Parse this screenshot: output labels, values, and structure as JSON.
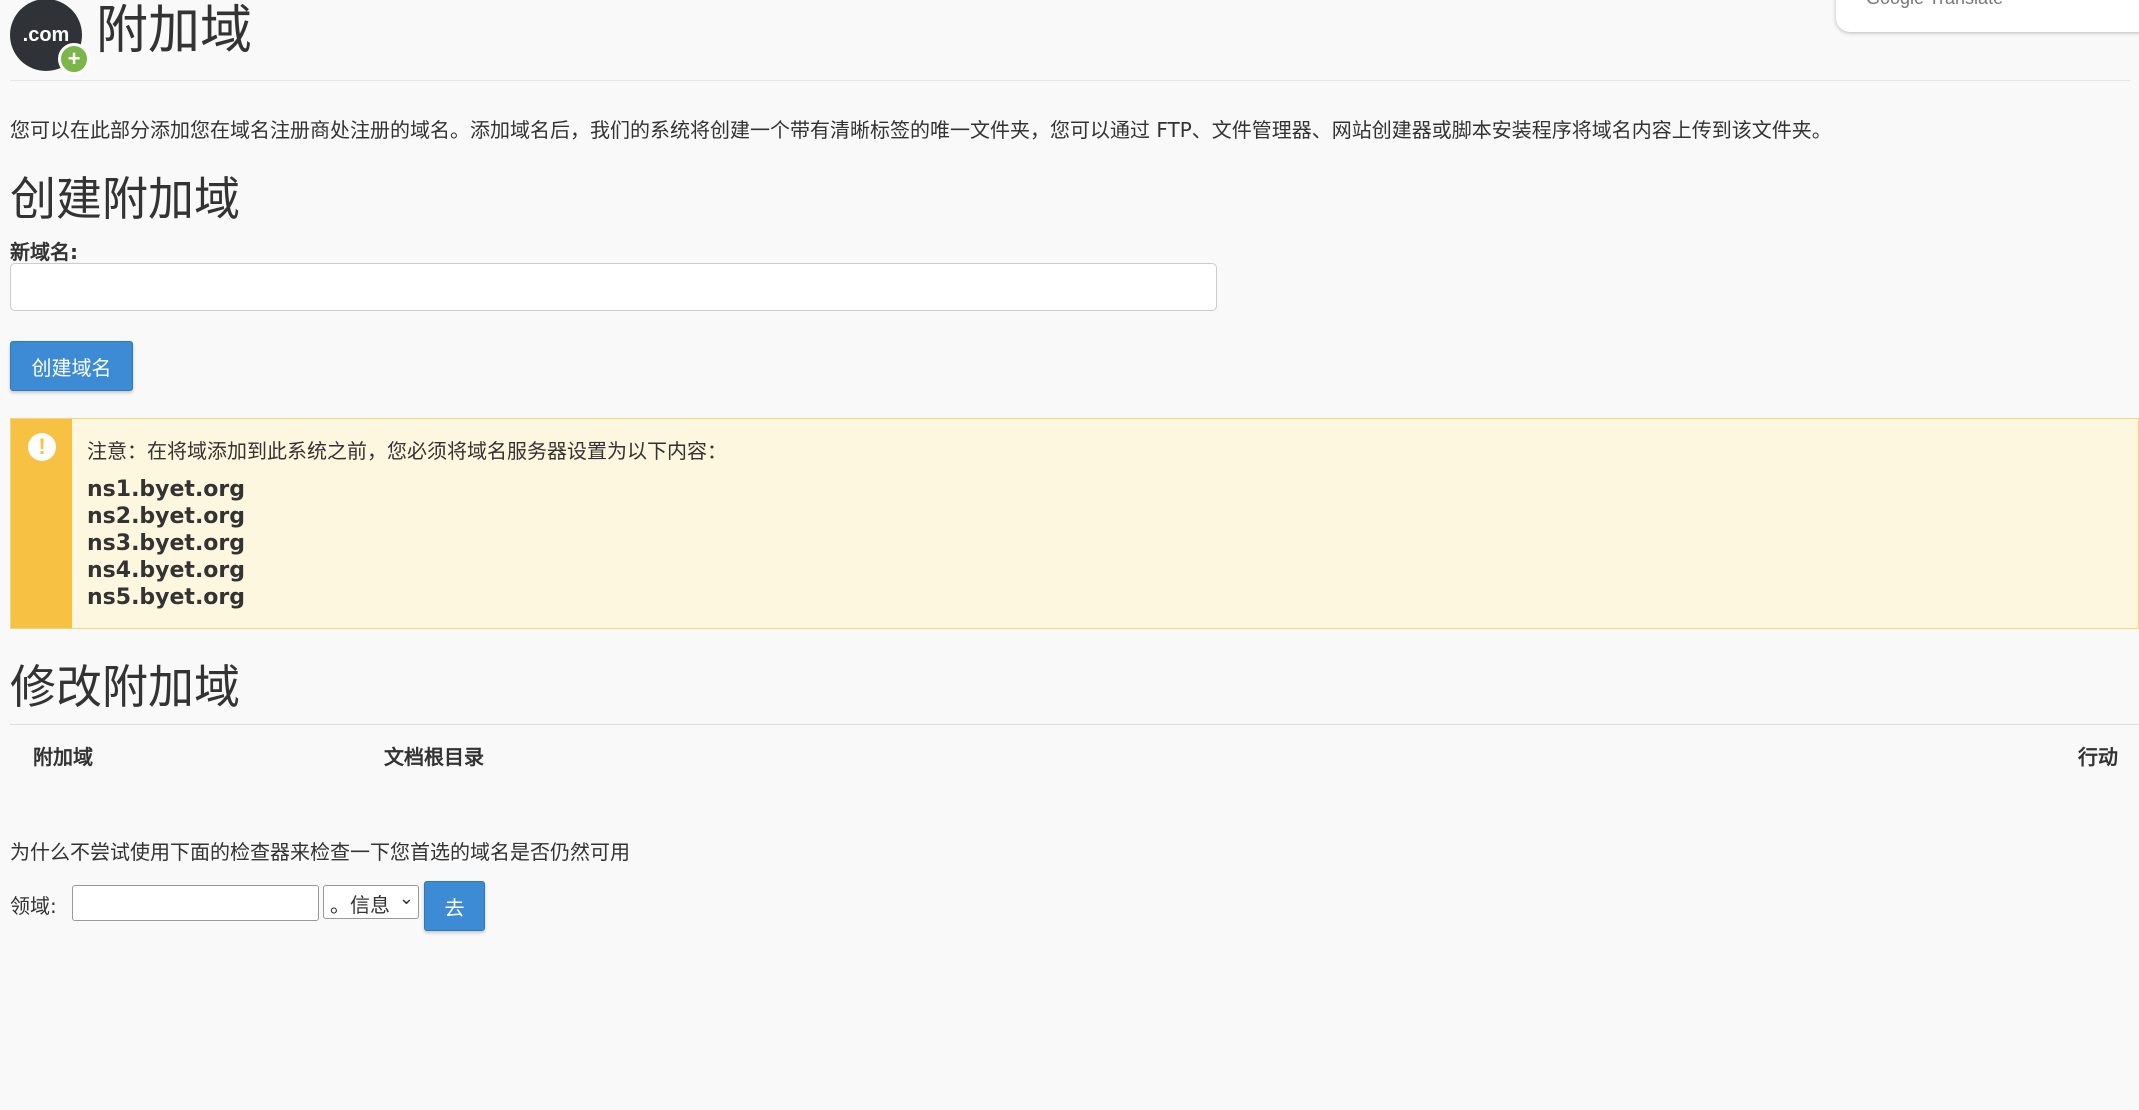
{
  "header": {
    "logo_text": ".com",
    "logo_badge": "+",
    "title": "附加域",
    "translate_widget": "Google Translate"
  },
  "intro": "您可以在此部分添加您在域名注册商处注册的域名。添加域名后，我们的系统将创建一个带有清晰标签的唯一文件夹，您可以通过 FTP、文件管理器、网站创建器或脚本安装程序将域名内容上传到该文件夹。",
  "create_section": {
    "heading": "创建附加域",
    "new_domain_label": "新域名:",
    "new_domain_value": "",
    "create_button": "创建域名"
  },
  "notice": {
    "icon": "exclamation-icon",
    "text": "注意：在将域添加到此系统之前，您必须将域名服务器设置为以下内容：",
    "nameservers": [
      "ns1.byet.org",
      "ns2.byet.org",
      "ns3.byet.org",
      "ns4.byet.org",
      "ns5.byet.org"
    ]
  },
  "modify_section": {
    "heading": "修改附加域",
    "columns": [
      "附加域",
      "文档根目录",
      "行动"
    ]
  },
  "domain_check": {
    "prompt": "为什么不尝试使用下面的检查器来检查一下您首选的域名是否仍然可用",
    "label": "领域:",
    "input_value": "",
    "tld_selected": "。信息",
    "go_button": "去"
  },
  "colors": {
    "primary_button": "#3d8bd4",
    "alert_bar": "#f7c243",
    "alert_background": "#fef7e0",
    "badge_green": "#7ab648"
  }
}
